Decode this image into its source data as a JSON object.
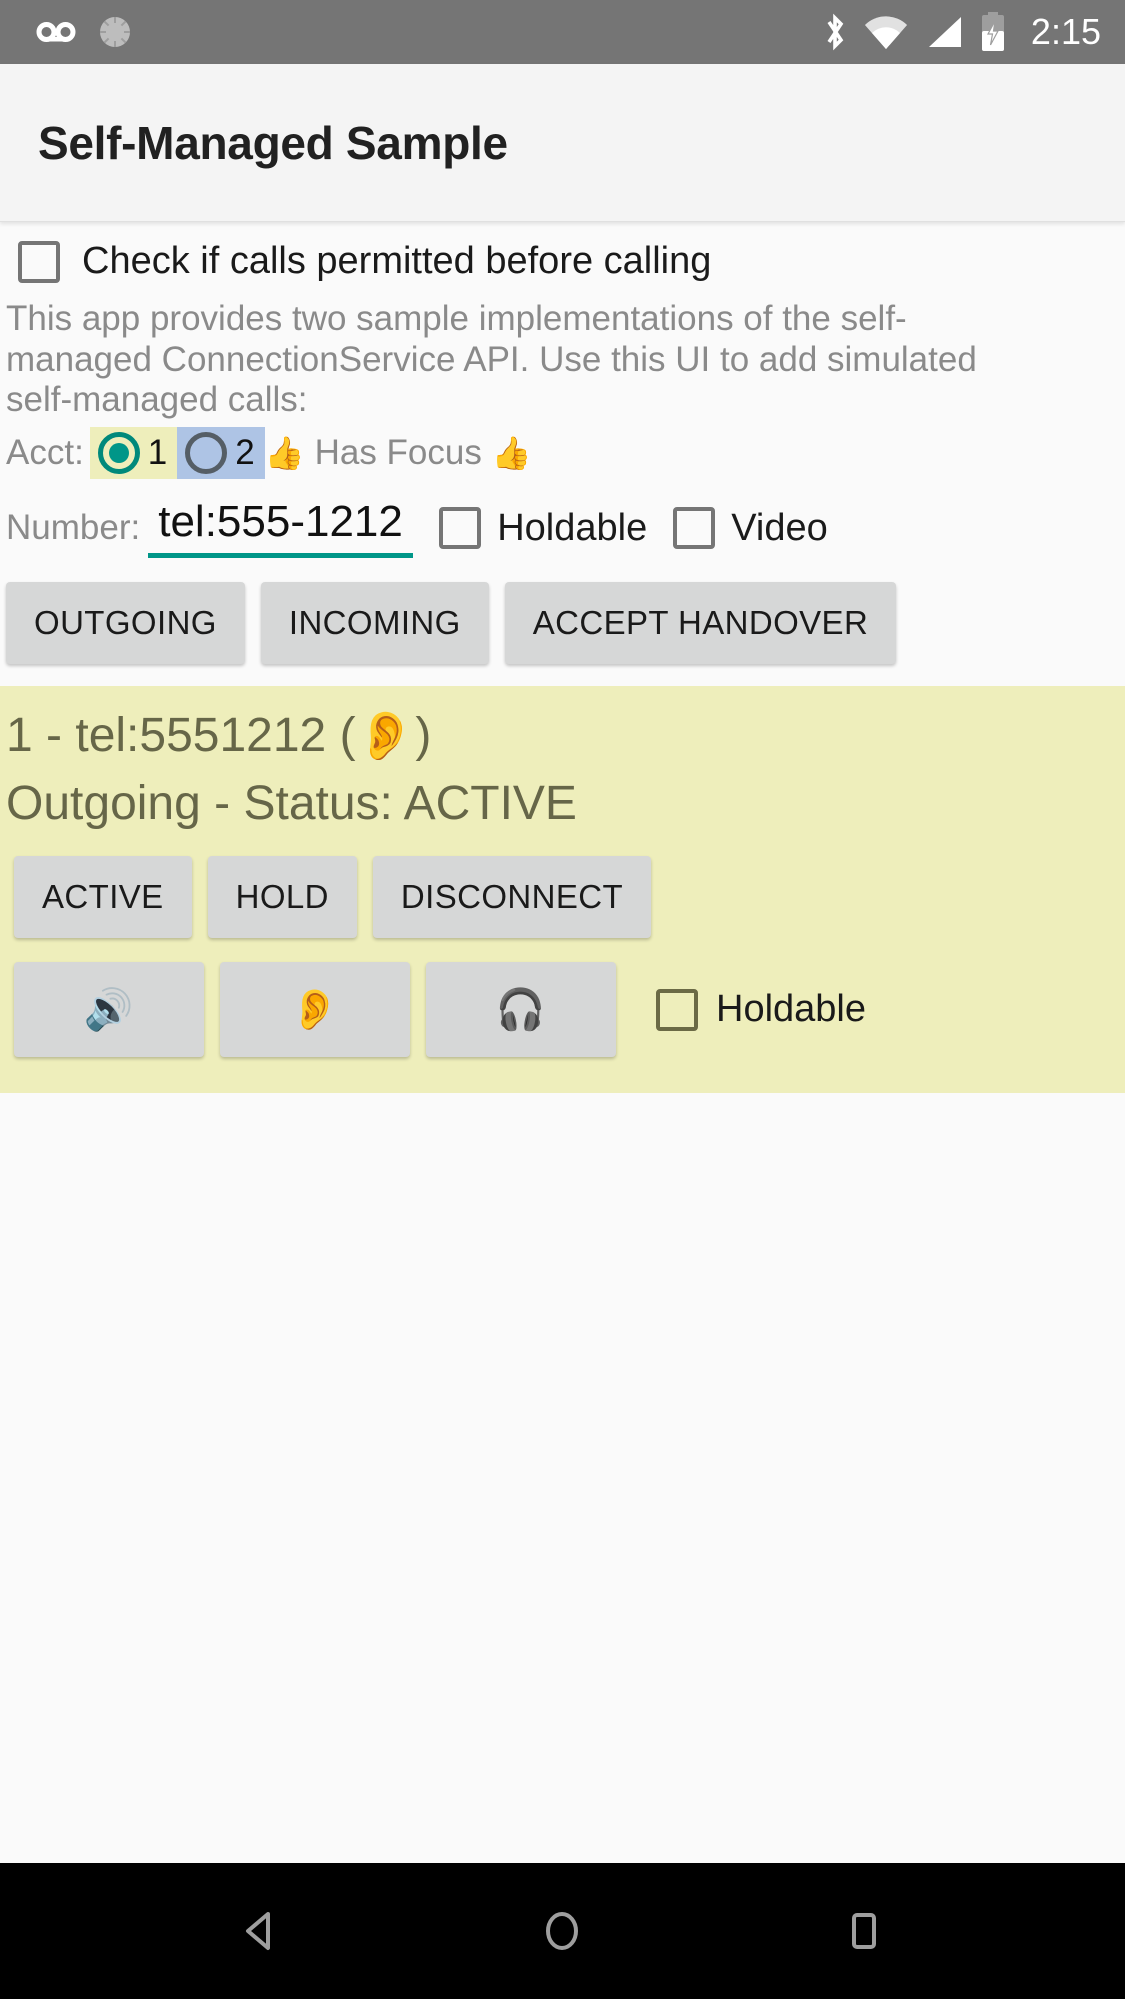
{
  "status_bar": {
    "icons_left": [
      "voicemail-icon",
      "sync-spinner-icon"
    ],
    "icons_right": [
      "bluetooth-icon",
      "wifi-icon",
      "cellular-signal-icon",
      "battery-charging-icon"
    ],
    "clock": "2:15",
    "background_color": "#757575",
    "icon_color": "#ffffff"
  },
  "app_bar": {
    "title": "Self-Managed Sample",
    "background_color": "#f4f4f4"
  },
  "permitted": {
    "label": "Check if calls permitted before calling",
    "checked": false
  },
  "description": "This app provides two sample implementations of the self-managed ConnectionService API.  Use this UI to add simulated self-managed calls:",
  "account": {
    "label": "Acct:",
    "options": [
      {
        "value": "1",
        "selected": true,
        "highlight_color": "#eeeebb"
      },
      {
        "value": "2",
        "selected": false,
        "highlight_color": "#aec4e5"
      }
    ],
    "focus_icon_left": "thumbs-up-icon",
    "focus_text": "Has Focus",
    "focus_icon_right": "thumbs-up-icon",
    "accent_color": "#009688"
  },
  "number": {
    "label": "Number:",
    "value": "tel:555-1212",
    "placeholder": "tel:555-1212",
    "underline_color": "#009688",
    "holdable": {
      "label": "Holdable",
      "checked": false
    },
    "video": {
      "label": "Video",
      "checked": false
    }
  },
  "actions": [
    {
      "label": "OUTGOING",
      "name": "outgoing-button"
    },
    {
      "label": "INCOMING",
      "name": "incoming-button"
    },
    {
      "label": "ACCEPT HANDOVER",
      "name": "accept-handover-button"
    }
  ],
  "call_card": {
    "background_color": "#eeeebb",
    "text_color": "#666648",
    "title_prefix": "1 - tel:5551212 ( ",
    "title_icon": "ear-icon",
    "title_suffix": " )",
    "status_line": "Outgoing - Status: ACTIVE",
    "state_buttons": [
      {
        "label": "ACTIVE",
        "name": "active-button"
      },
      {
        "label": "HOLD",
        "name": "hold-button"
      },
      {
        "label": "DISCONNECT",
        "name": "disconnect-button"
      }
    ],
    "route_buttons": [
      {
        "icon": "speaker-icon",
        "glyph": "🔊",
        "name": "speaker-route-button"
      },
      {
        "icon": "ear-icon",
        "glyph": "👂",
        "name": "earpiece-route-button"
      },
      {
        "icon": "headset-icon",
        "glyph": "🎧",
        "name": "headset-route-button"
      }
    ],
    "holdable": {
      "label": "Holdable",
      "checked": false
    }
  },
  "nav_bar": {
    "background_color": "#000000",
    "buttons": [
      "back-nav-button",
      "home-nav-button",
      "recents-nav-button"
    ]
  }
}
